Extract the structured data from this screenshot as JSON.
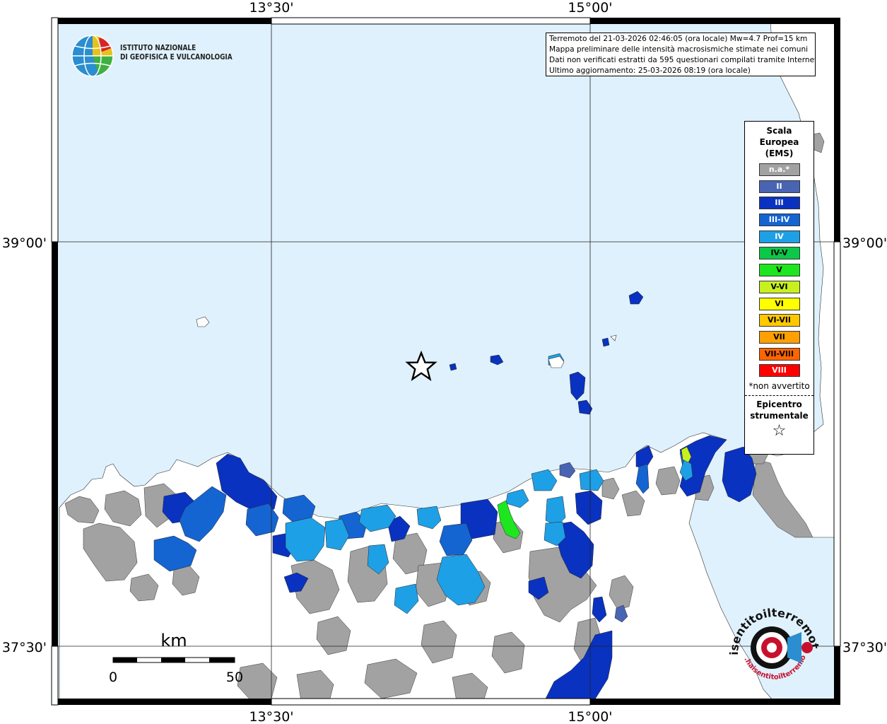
{
  "map": {
    "colors": {
      "sea": "#dff1fc",
      "land_not_reported": "#ffffff",
      "land_unfelt": "#a2a2a2",
      "grid": "#222222",
      "frame": "#000000"
    },
    "lon_labels": [
      "13°30'",
      "15°00'"
    ],
    "lat_labels": [
      "39°00'",
      "37°30'"
    ],
    "scale_bar": {
      "unit": "km",
      "start": "0",
      "end": "50"
    },
    "epicenter_icon": "star-outline-icon"
  },
  "info": {
    "line1": "Terremoto del 21-03-2026 02:46:05 (ora locale) Mw=4.7 Prof=15 km",
    "line2": "Mappa preliminare delle intensità macrosismiche stimate nei comuni",
    "line3": "Dati non verificati estratti da 595 questionari compilati tramite Internet.",
    "line4": "Ultimo aggiornamento: 25-03-2026 08:19 (ora locale)"
  },
  "legend": {
    "title1": "Scala",
    "title2": "Europea",
    "title3": "(EMS)",
    "items": [
      {
        "label": "n.a.*",
        "color": "#a2a2a2",
        "text": "#ffffff"
      },
      {
        "label": "II",
        "color": "#4a64b4",
        "text": "#ffffff"
      },
      {
        "label": "III",
        "color": "#0a32c0",
        "text": "#ffffff"
      },
      {
        "label": "III-IV",
        "color": "#1464d2",
        "text": "#ffffff"
      },
      {
        "label": "IV",
        "color": "#1ea0e6",
        "text": "#ffffff"
      },
      {
        "label": "IV-V",
        "color": "#0cc848",
        "text": "#000000"
      },
      {
        "label": "V",
        "color": "#1ee61e",
        "text": "#000000"
      },
      {
        "label": "V-VI",
        "color": "#c8f01e",
        "text": "#000000"
      },
      {
        "label": "VI",
        "color": "#ffff00",
        "text": "#000000"
      },
      {
        "label": "VI-VII",
        "color": "#ffc800",
        "text": "#000000"
      },
      {
        "label": "VII",
        "color": "#ffa000",
        "text": "#000000"
      },
      {
        "label": "VII-VIII",
        "color": "#ff6400",
        "text": "#000000"
      },
      {
        "label": "VIII",
        "color": "#ff0000",
        "text": "#ffffff"
      }
    ],
    "note": "*non avvertito",
    "epicenter1": "Epicentro",
    "epicenter2": "strumentale",
    "star": "☆"
  },
  "logos": {
    "ingv_line1": "ISTITUTO NAZIONALE",
    "ingv_line2": "DI GEOFISICA E VULCANOLOGIA",
    "hsit_text": "haisentitoilterremoto.it",
    "hsit_url": "www.haisentitoilterremoto.it"
  }
}
